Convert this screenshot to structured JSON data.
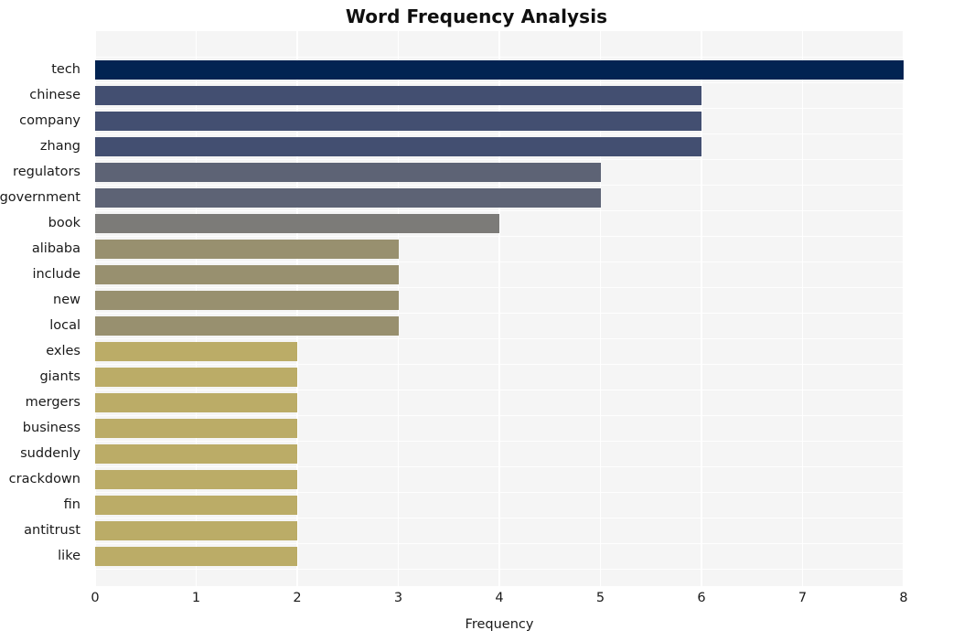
{
  "chart_data": {
    "type": "bar",
    "orientation": "horizontal",
    "title": "Word Frequency Analysis",
    "xlabel": "Frequency",
    "ylabel": "",
    "xlim": [
      0,
      8
    ],
    "xticks": [
      0,
      1,
      2,
      3,
      4,
      5,
      6,
      7,
      8
    ],
    "xtick_labels": [
      "0",
      "1",
      "2",
      "3",
      "4",
      "5",
      "6",
      "7",
      "8"
    ],
    "grid": true,
    "legend": null,
    "categories": [
      "tech",
      "chinese",
      "company",
      "zhang",
      "regulators",
      "government",
      "book",
      "alibaba",
      "include",
      "new",
      "local",
      "exles",
      "giants",
      "mergers",
      "business",
      "suddenly",
      "crackdown",
      "fin",
      "antitrust",
      "like"
    ],
    "values": [
      8,
      6,
      6,
      6,
      5,
      5,
      4,
      3,
      3,
      3,
      3,
      2,
      2,
      2,
      2,
      2,
      2,
      2,
      2,
      2
    ],
    "bar_colors": [
      "#022352",
      "#434f71",
      "#434f71",
      "#434f71",
      "#5d6375",
      "#5d6375",
      "#7c7b78",
      "#98906f",
      "#98906f",
      "#98906f",
      "#98906f",
      "#bbac67",
      "#bbac67",
      "#bbac67",
      "#bbac67",
      "#bbac67",
      "#bbac67",
      "#bbac67",
      "#bbac67",
      "#bbac67"
    ],
    "colormap": "cividis"
  },
  "style": {
    "plot_background": "#f5f5f5",
    "figure_background": "#ffffff",
    "gridline_color": "#ffffff",
    "text_color": "#1a1a1a",
    "title_color": "#101010"
  }
}
